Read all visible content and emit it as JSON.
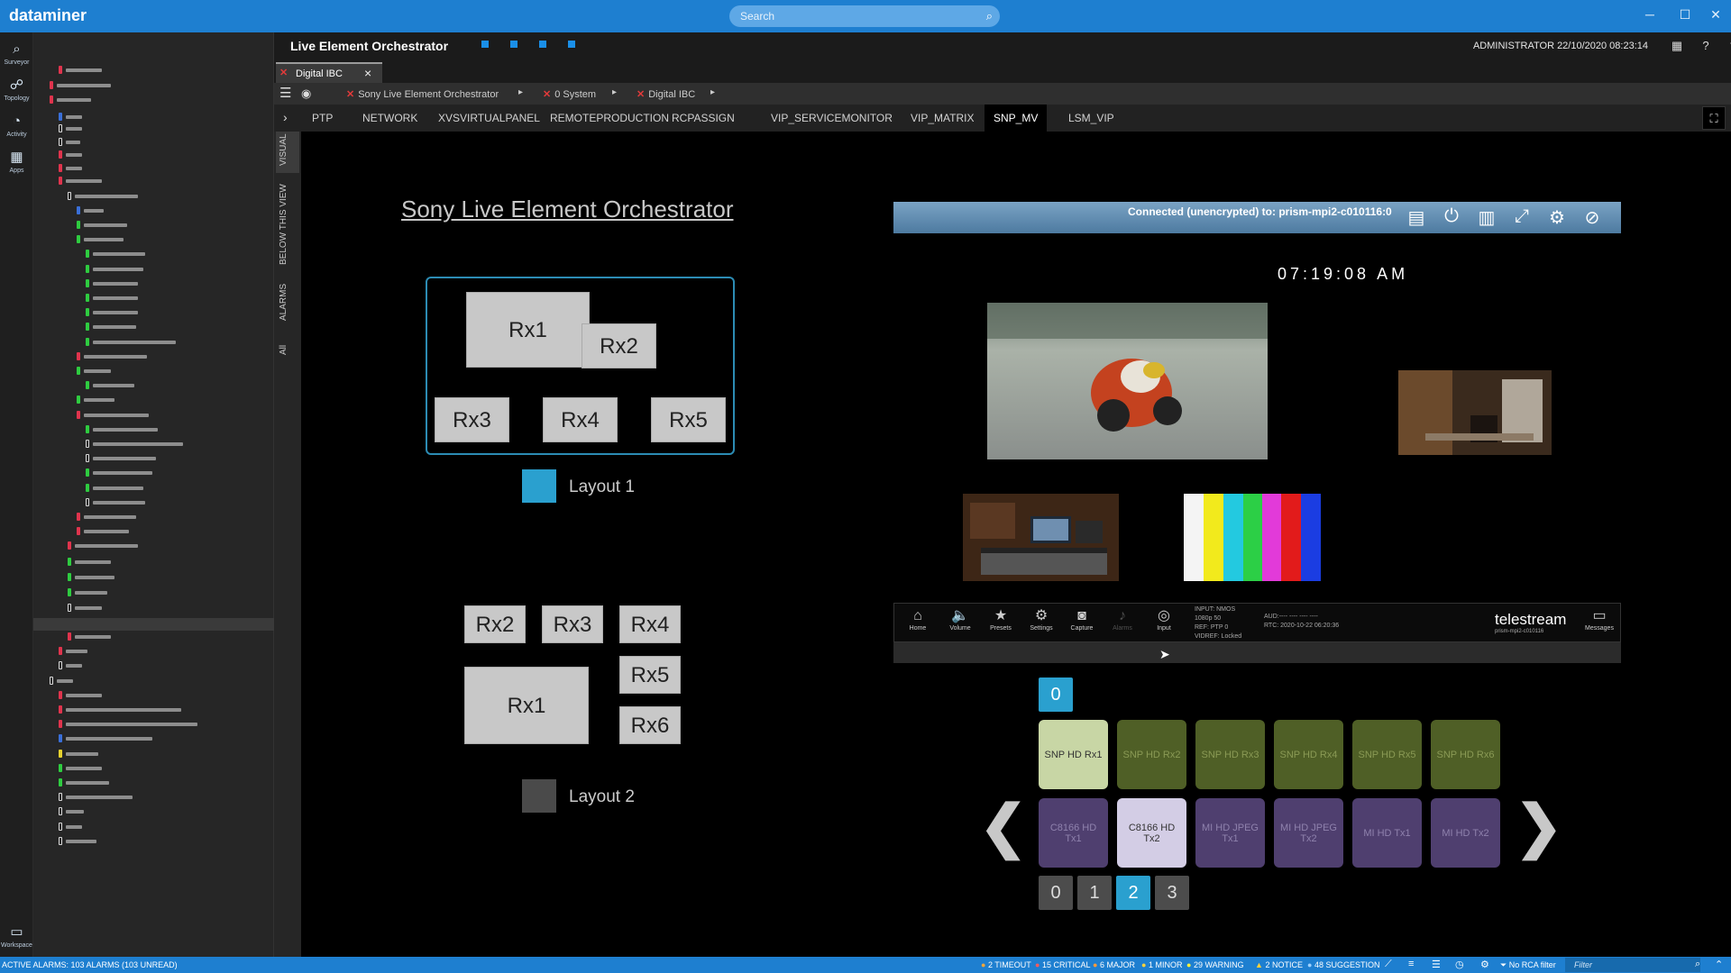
{
  "app": {
    "brand": "dataminer"
  },
  "search": {
    "placeholder": "Search"
  },
  "rail": [
    {
      "label": "Surveyor",
      "icon": "surveyor-icon"
    },
    {
      "label": "Topology",
      "icon": "topology-icon"
    },
    {
      "label": "Activity",
      "icon": "activity-icon"
    },
    {
      "label": "Apps",
      "icon": "apps-icon"
    },
    {
      "label": "Workspace",
      "icon": "workspace-icon"
    }
  ],
  "header": {
    "title": "Live Element Orchestrator",
    "user": "ADMINISTRATOR 22/10/2020 08:23:14"
  },
  "card_tab": {
    "label": "Digital IBC"
  },
  "breadcrumb": [
    "Sony Live Element Orchestrator",
    "0 System",
    "Digital IBC"
  ],
  "page_tabs": [
    "PTP",
    "NETWORK",
    "XVSVIRTUALPANEL",
    "REMOTEPRODUCTION",
    "RCPASSIGN",
    "VIP_SERVICEMONITOR",
    "VIP_MATRIX",
    "SNP_MV",
    "LSM_VIP"
  ],
  "active_tab": "SNP_MV",
  "vertical_tabs": [
    "VISUAL",
    "BELOW THIS VIEW",
    "ALARMS",
    "All"
  ],
  "visual": {
    "title": "Sony Live Element Orchestrator",
    "layout1": {
      "label": "Layout 1",
      "color": "#2aa0cf",
      "tiles": [
        "Rx1",
        "Rx2",
        "Rx3",
        "Rx4",
        "Rx5"
      ]
    },
    "layout2": {
      "label": "Layout 2",
      "color": "#4a4a4a",
      "tiles": [
        "Rx2",
        "Rx3",
        "Rx4",
        "Rx5",
        "Rx1",
        "Rx6"
      ]
    }
  },
  "multiviewer": {
    "connection": "Connected (unencrypted) to: prism-mpi2-c010116:0",
    "clock": "07:19:08 AM",
    "toolbar": [
      "Home",
      "Volume",
      "Presets",
      "Settings",
      "Capture",
      "Alarms",
      "Input"
    ],
    "info": {
      "input": "INPUT: NMOS",
      "format": "1080p 50",
      "ref": "REF: PTP 0",
      "vidref": "VIDREF: Locked",
      "aud": "AUD:---- ---- ---- ----",
      "rtc": "RTC: 2020-10-22 06:20:36"
    },
    "brand": "telestream",
    "brand_sub": "prism-mpi2-c010116",
    "messages": "Messages"
  },
  "selector": {
    "top_page": "0",
    "row1": [
      "SNP HD Rx1",
      "SNP HD Rx2",
      "SNP HD Rx3",
      "SNP HD Rx4",
      "SNP HD Rx5",
      "SNP HD Rx6"
    ],
    "row2": [
      "C8166 HD Tx1",
      "C8166 HD Tx2",
      "MI HD JPEG Tx1",
      "MI HD JPEG Tx2",
      "MI HD Tx1",
      "MI HD Tx2"
    ],
    "pages": [
      "0",
      "1",
      "2",
      "3"
    ],
    "selected_page": "2",
    "prev": "❮",
    "next": "❯"
  },
  "status": {
    "alarms": "ACTIVE ALARMS: 103 ALARMS (103 UNREAD)",
    "counts": [
      "2 TIMEOUT",
      "15 CRITICAL",
      "6 MAJOR",
      "1 MINOR",
      "29 WARNING",
      "2 NOTICE",
      "48 SUGGESTION"
    ],
    "rca": "No RCA filter",
    "filter_placeholder": "Filter"
  }
}
